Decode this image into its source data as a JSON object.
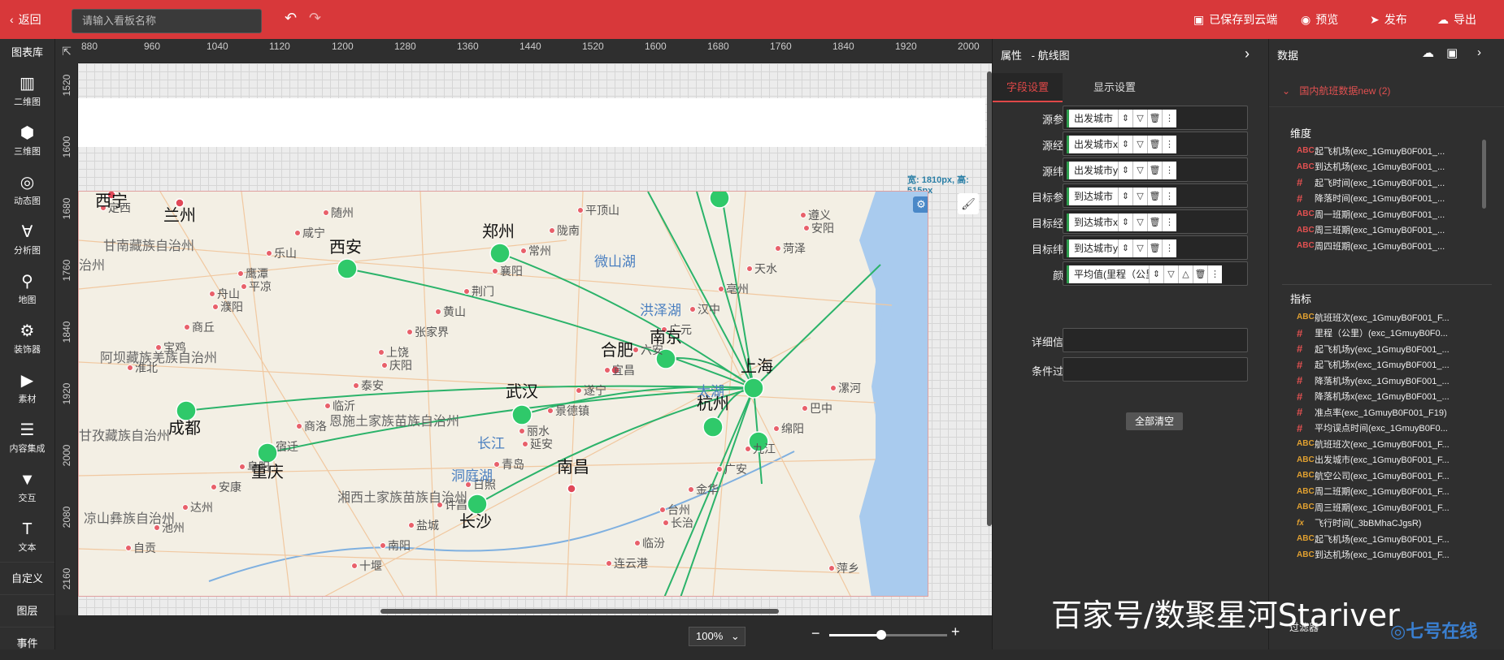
{
  "topbar": {
    "back": "返回",
    "board_placeholder": "请输入看板名称",
    "saved": "已保存到云端",
    "preview": "预览",
    "publish": "发布",
    "export": "导出"
  },
  "leftbar": {
    "header": "图表库",
    "items": [
      {
        "label": "二维图",
        "icon": "bar-chart-icon"
      },
      {
        "label": "三维图",
        "icon": "cube-icon"
      },
      {
        "label": "动态图",
        "icon": "pulse-icon"
      },
      {
        "label": "分析图",
        "icon": "analysis-icon"
      },
      {
        "label": "地图",
        "icon": "map-pin-icon"
      },
      {
        "label": "装饰器",
        "icon": "gear-icon"
      },
      {
        "label": "素材",
        "icon": "play-box-icon"
      },
      {
        "label": "内容集成",
        "icon": "layers-icon"
      },
      {
        "label": "交互",
        "icon": "funnel-icon"
      },
      {
        "label": "文本",
        "icon": "text-icon"
      }
    ],
    "custom": "自定义",
    "layers": "图层",
    "events": "事件"
  },
  "rulers": {
    "top": [
      "880",
      "960",
      "1040",
      "1120",
      "1200",
      "1280",
      "1360",
      "1440",
      "1520",
      "1600",
      "1680",
      "1760",
      "1840",
      "1920",
      "2000"
    ],
    "left": [
      "1520",
      "1600",
      "1680",
      "1760",
      "1840",
      "1920",
      "2000",
      "2080",
      "2160"
    ]
  },
  "canvas": {
    "size_label": "宽: 1810px, 高: 515px"
  },
  "map": {
    "cities_major": [
      "西安",
      "郑州",
      "南京",
      "上海",
      "合肥",
      "武汉",
      "成都",
      "重庆",
      "长沙",
      "南昌",
      "杭州",
      "兰州",
      "西宁"
    ],
    "cities_minor": [
      "定西",
      "平凉",
      "庆阳",
      "延安",
      "长治",
      "安阳",
      "濮阳",
      "泰安",
      "青岛",
      "临汾",
      "菏泽",
      "商丘",
      "临沂",
      "日照",
      "连云港",
      "天水",
      "宝鸡",
      "商洛",
      "许昌",
      "平顶山",
      "亳州",
      "淮北",
      "宿迁",
      "盐城",
      "陇南",
      "汉中",
      "漯河",
      "阜阳",
      "南阳",
      "常州",
      "广元",
      "巴中",
      "安康",
      "十堰",
      "襄阳",
      "六安",
      "绵阳",
      "达州",
      "随州",
      "荆门",
      "宜昌",
      "九江",
      "池州",
      "咸宁",
      "黄山",
      "遂宁",
      "广安",
      "自贡",
      "乐山",
      "张家界",
      "景德镇",
      "金华",
      "萍乡",
      "鹰潭",
      "上饶",
      "丽水",
      "台州",
      "遵义",
      "舟山"
    ],
    "regions": [
      "甘南藏族自治州",
      "阿坝藏族羌族自治州",
      "甘孜藏族自治州",
      "凉山彝族自治州",
      "恩施土家族苗族自治州",
      "湘西土家族苗族自治州",
      "治州"
    ],
    "water": [
      "微山湖",
      "洪泽湖",
      "太湖",
      "长江",
      "洞庭湖"
    ]
  },
  "zoom": {
    "value": "100%",
    "level": 0.44
  },
  "props": {
    "title": "属性",
    "chart_type": "航线图",
    "tab_field": "字段设置",
    "tab_display": "显示设置",
    "rows": [
      {
        "label": "源参数",
        "field": "出发城市"
      },
      {
        "label": "源经度",
        "field": "出发城市x"
      },
      {
        "label": "源纬度",
        "field": "出发城市y"
      },
      {
        "label": "目标参数",
        "field": "到达城市"
      },
      {
        "label": "目标经度",
        "field": "到达城市x"
      },
      {
        "label": "目标纬度",
        "field": "到达城市y"
      },
      {
        "label": "颜色",
        "field": "平均值(里程（公里"
      }
    ],
    "detail_label": "详细信息",
    "filter_label": "条件过滤",
    "clear_all": "全部清空"
  },
  "data": {
    "title": "数据",
    "dataset": "国内航班数据new (2)",
    "dimensions_title": "维度",
    "dimensions": [
      {
        "type": "abc",
        "name": "起飞机场(exc_1GmuyB0F001_..."
      },
      {
        "type": "abc",
        "name": "到达机场(exc_1GmuyB0F001_..."
      },
      {
        "type": "num",
        "name": "起飞时间(exc_1GmuyB0F001_..."
      },
      {
        "type": "num",
        "name": "降落时间(exc_1GmuyB0F001_..."
      },
      {
        "type": "abc",
        "name": "周一班期(exc_1GmuyB0F001_..."
      },
      {
        "type": "abc",
        "name": "周三班期(exc_1GmuyB0F001_..."
      },
      {
        "type": "abc",
        "name": "周四班期(exc_1GmuyB0F001_..."
      }
    ],
    "metrics_title": "指标",
    "metrics": [
      {
        "type": "abc",
        "name": "航班班次(exc_1GmuyB0F001_F..."
      },
      {
        "type": "num",
        "name": "里程（公里）(exc_1GmuyB0F0..."
      },
      {
        "type": "num",
        "name": "起飞机场y(exc_1GmuyB0F001_..."
      },
      {
        "type": "num",
        "name": "起飞机场x(exc_1GmuyB0F001_..."
      },
      {
        "type": "num",
        "name": "降落机场y(exc_1GmuyB0F001_..."
      },
      {
        "type": "num",
        "name": "降落机场x(exc_1GmuyB0F001_..."
      },
      {
        "type": "num",
        "name": "准点率(exc_1GmuyB0F001_F19)"
      },
      {
        "type": "num",
        "name": "平均误点时间(exc_1GmuyB0F0..."
      },
      {
        "type": "abc",
        "name": "航班班次(exc_1GmuyB0F001_F..."
      },
      {
        "type": "abc",
        "name": "出发城市(exc_1GmuyB0F001_F..."
      },
      {
        "type": "abc",
        "name": "航空公司(exc_1GmuyB0F001_F..."
      },
      {
        "type": "abc",
        "name": "周二班期(exc_1GmuyB0F001_F..."
      },
      {
        "type": "abc",
        "name": "周三班期(exc_1GmuyB0F001_F..."
      },
      {
        "type": "fx",
        "name": "飞行时间(_3bBMhaCJgsR)"
      },
      {
        "type": "abc",
        "name": "起飞机场(exc_1GmuyB0F001_F..."
      },
      {
        "type": "abc",
        "name": "到达机场(exc_1GmuyB0F001_F..."
      }
    ],
    "filter_label": "过滤器"
  },
  "watermark": {
    "text": "百家号/数聚星河Stariver",
    "logo_text": "七号在线"
  }
}
